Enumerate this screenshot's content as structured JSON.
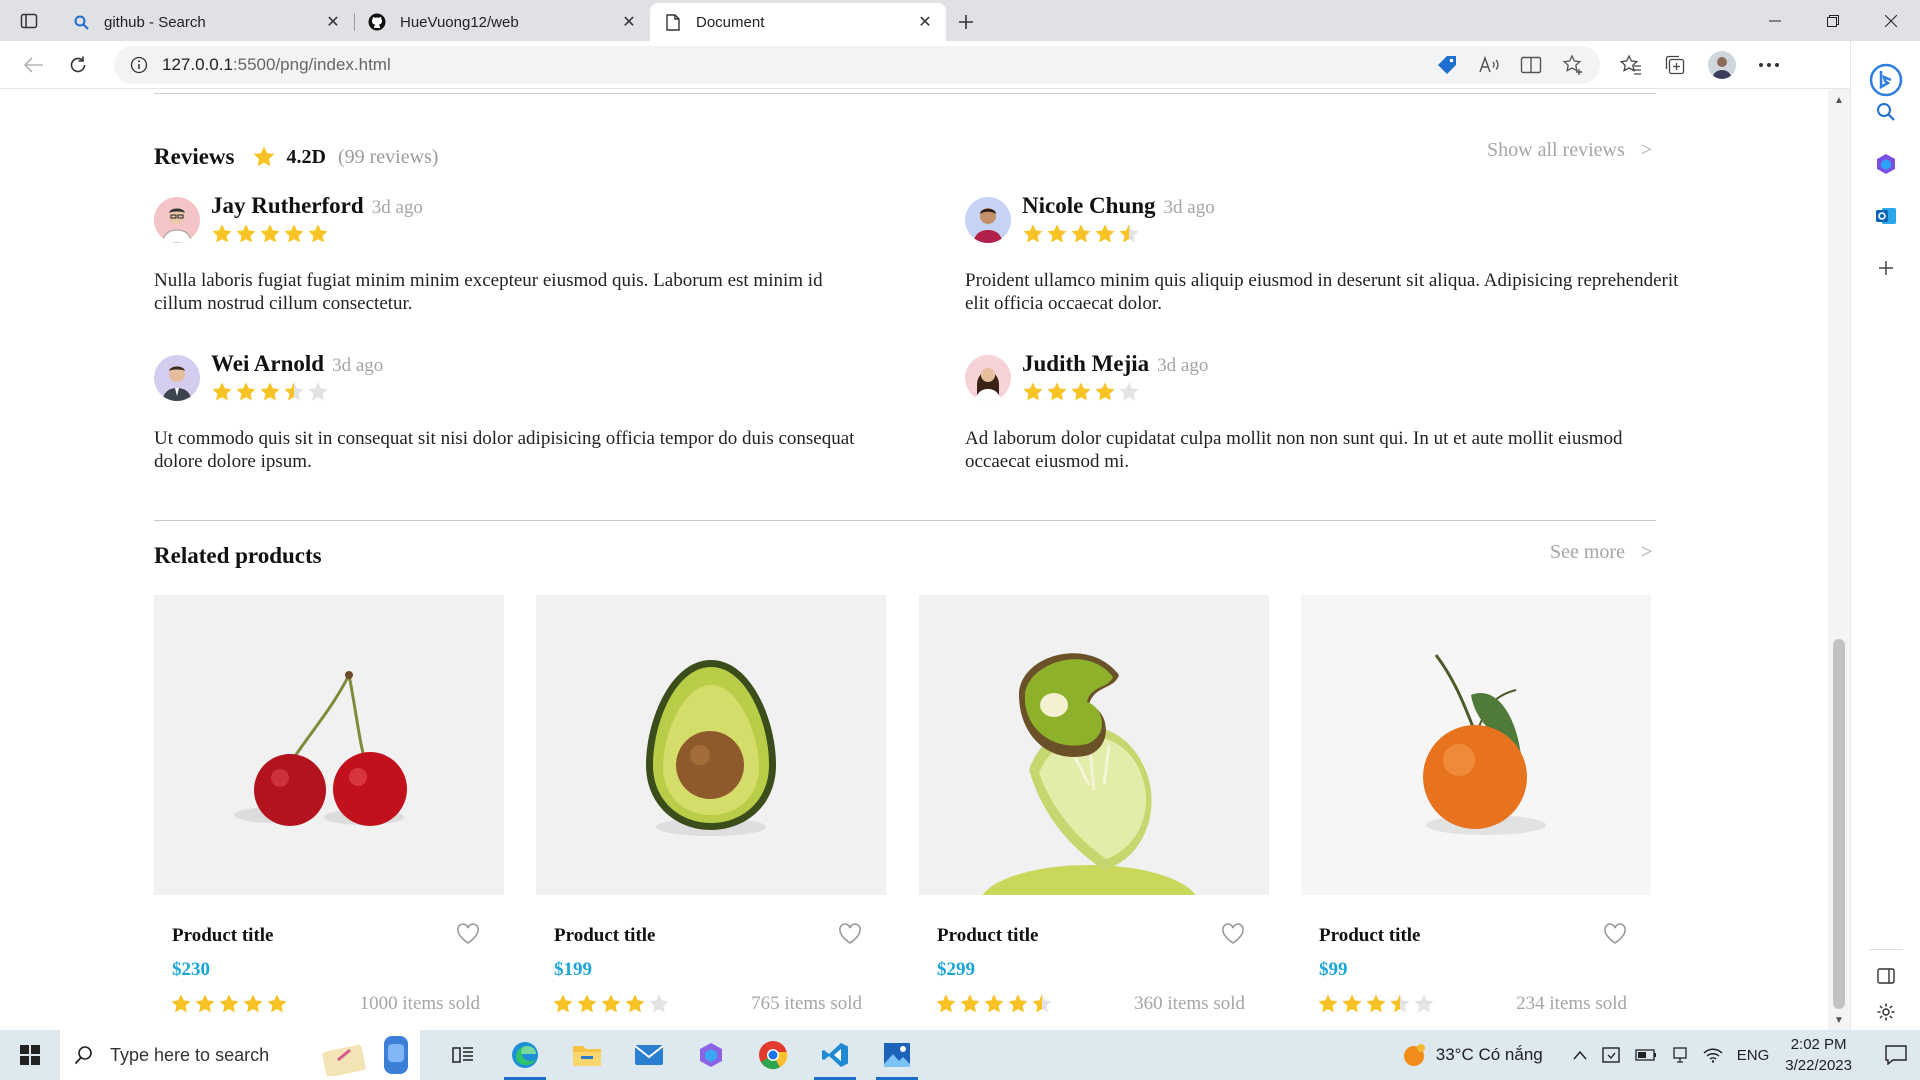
{
  "browser": {
    "tabs": [
      {
        "title": "github - Search",
        "icon": "search-icon",
        "active": false
      },
      {
        "title": "HueVuong12/web",
        "icon": "github-icon",
        "active": false
      },
      {
        "title": "Document",
        "icon": "document-icon",
        "active": true
      }
    ],
    "address": {
      "host": "127.0.0.1",
      "path": ":5500/png/index.html"
    }
  },
  "reviews": {
    "title": "Reviews",
    "rating": "4.2D",
    "count": "(99 reviews)",
    "show_all": "Show all reviews",
    "chevron": ">",
    "items": [
      {
        "name": "Jay Rutherford",
        "ago": "3d ago",
        "rating": 5,
        "text": "Nulla laboris fugiat fugiat minim minim excepteur eiusmod quis. Laborum est minim id cillum nostrud cillum consectetur."
      },
      {
        "name": "Nicole Chung",
        "ago": "3d ago",
        "rating": 4.5,
        "text": "Proident ullamco minim quis aliquip eiusmod in deserunt sit aliqua. Adipisicing reprehenderit elit officia occaecat dolor."
      },
      {
        "name": "Wei Arnold",
        "ago": "3d ago",
        "rating": 3.5,
        "text": "Ut commodo quis sit in consequat sit nisi dolor adipisicing officia tempor do duis consequat dolore dolore ipsum."
      },
      {
        "name": "Judith Mejia",
        "ago": "3d ago",
        "rating": 4,
        "text": "Ad laborum dolor cupidatat culpa mollit non non sunt qui. In ut et aute mollit eiusmod occaecat eiusmod mi."
      }
    ]
  },
  "related": {
    "title": "Related products",
    "see_more": "See more",
    "chevron": ">",
    "products": [
      {
        "title": "Product title",
        "price": "$230",
        "rating": 5,
        "sold": "1000 items sold"
      },
      {
        "title": "Product title",
        "price": "$199",
        "rating": 4,
        "sold": "765 items sold"
      },
      {
        "title": "Product title",
        "price": "$299",
        "rating": 4.5,
        "sold": "360 items sold"
      },
      {
        "title": "Product title",
        "price": "$99",
        "rating": 3.5,
        "sold": "234 items sold"
      }
    ]
  },
  "taskbar": {
    "search_placeholder": "Type here to search",
    "weather": "33°C  Có nắng",
    "lang": "ENG",
    "time": "2:02 PM",
    "date": "3/22/2023"
  },
  "colors": {
    "star": "#f7c325",
    "star_empty": "#e3e3e3",
    "price": "#1aa6d8",
    "muted": "#a5a5a5"
  }
}
